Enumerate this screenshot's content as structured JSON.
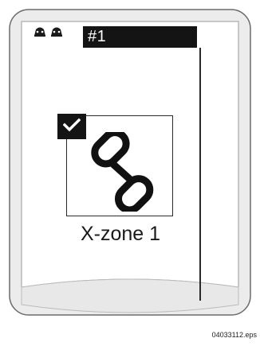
{
  "status": {
    "icon": "people-pair-icon"
  },
  "header": {
    "id_label": "#1"
  },
  "zone": {
    "checked": true,
    "icon": "link-icon",
    "label": "X-zone 1"
  },
  "footer": {
    "file_code": "04033112.eps"
  }
}
